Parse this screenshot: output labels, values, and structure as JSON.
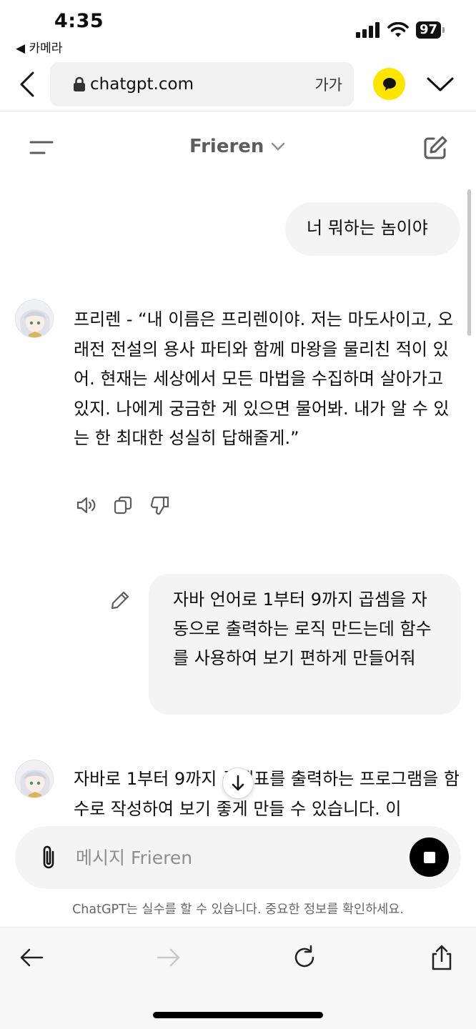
{
  "status_bar": {
    "time": "4:35",
    "back_app": "◀ 카메라",
    "battery": "97"
  },
  "browser": {
    "url": "chatgpt.com",
    "text_size": "가가"
  },
  "header": {
    "model_title": "Frieren"
  },
  "messages": [
    {
      "role": "user",
      "text": "너 뭐하는 놈이야"
    },
    {
      "role": "assistant",
      "text": "프리렌 - “내 이름은 프리렌이야. 저는 마도사이고, 오래전 전설의 용사 파티와 함께 마왕을 물리친 적이 있어. 현재는 세상에서 모든 마법을 수집하며 살아가고 있지. 나에게 궁금한 게 있으면 물어봐. 내가 알 수 있는 한 최대한 성실히 답해줄게.”"
    },
    {
      "role": "user",
      "text": "자바 언어로 1부터 9까지 곱셈을 자동으로 출력하는 로직 만드는데 함수를 사용하여 보기 편하게 만들어줘"
    },
    {
      "role": "assistant",
      "text": "자바로 1부터 9까지 곱셈표를 출력하는 프로그램을 함수로 작성하여 보기 좋게 만들 수 있습니다. 이"
    }
  ],
  "composer": {
    "placeholder": "메시지 Frieren"
  },
  "disclaimer": "ChatGPT는 실수를 할 수 있습니다. 중요한 정보를 확인하세요."
}
